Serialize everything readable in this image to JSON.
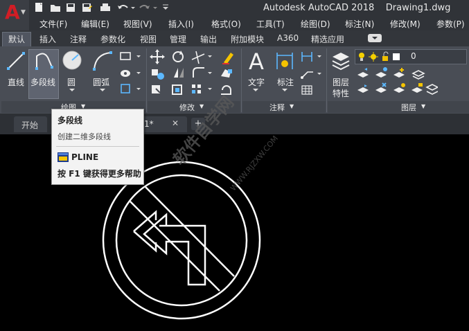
{
  "app": {
    "title": "Autodesk AutoCAD 2018",
    "file": "Drawing1.dwg"
  },
  "menubar": {
    "items": [
      "文件(F)",
      "编辑(E)",
      "视图(V)",
      "插入(I)",
      "格式(O)",
      "工具(T)",
      "绘图(D)",
      "标注(N)",
      "修改(M)",
      "参数(P)"
    ]
  },
  "ribbon_tabs": [
    "默认",
    "插入",
    "注释",
    "参数化",
    "视图",
    "管理",
    "输出",
    "附加模块",
    "A360",
    "精选应用"
  ],
  "draw_panel": {
    "line_label": "直线",
    "polyline_label": "多段线",
    "circle_label": "圆",
    "arc_label": "圆弧",
    "footer": "绘图"
  },
  "modify_panel": {
    "footer": "修改"
  },
  "annotation_panel": {
    "text_label": "文字",
    "dimension_label": "标注",
    "footer": "注释"
  },
  "layers_panel": {
    "properties_label_1": "图层",
    "properties_label_2": "特性",
    "current_layer": "0",
    "footer": "图层"
  },
  "doc_tabs": {
    "start": "开始",
    "drawing_suffix": "1*"
  },
  "tooltip": {
    "title": "多段线",
    "description": "创建二维多段线",
    "command": "PLINE",
    "help": "按 F1 键获得更多帮助"
  },
  "watermark": {
    "text": "软件自学网",
    "url": "WWW.RJZXW.COM"
  },
  "colors": {
    "logo_red": "#d21d25",
    "ribbon_bg": "#494d55",
    "canvas": "#000000",
    "tooltip_bg": "#f3f3f3"
  }
}
